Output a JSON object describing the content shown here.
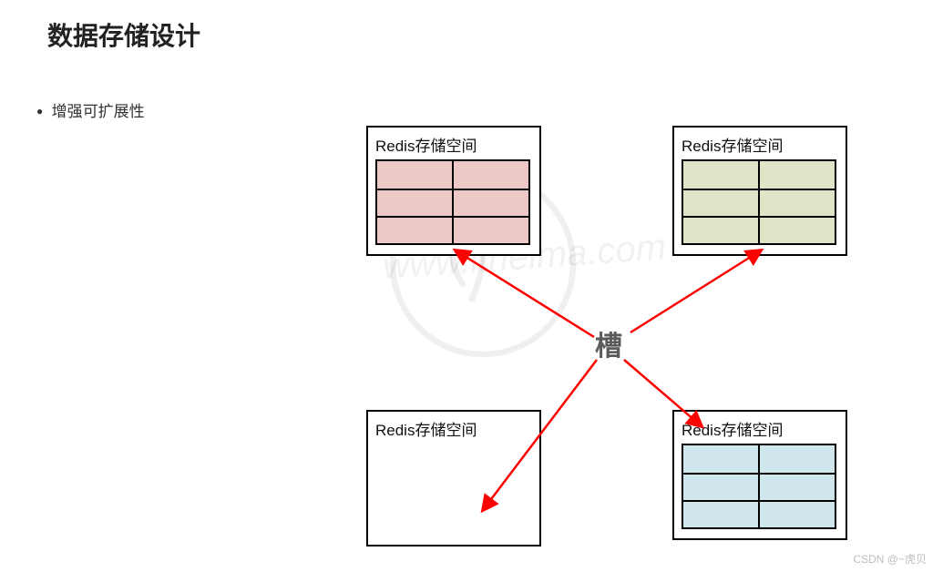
{
  "title": "数据存储设计",
  "bullet": "增强可扩展性",
  "boxes": {
    "tl": {
      "label": "Redis存储空间"
    },
    "tr": {
      "label": "Redis存储空间"
    },
    "bl": {
      "label": "Redis存储空间"
    },
    "br": {
      "label": "Redis存储空间"
    }
  },
  "centerLabel": "槽",
  "watermark_url": "www.itheima.com",
  "footer": "CSDN @~虎贝",
  "colors": {
    "arrow": "#ff0000",
    "pink": "#edc8c7",
    "green": "#e0e3c5",
    "blue": "#cfe6ed"
  }
}
